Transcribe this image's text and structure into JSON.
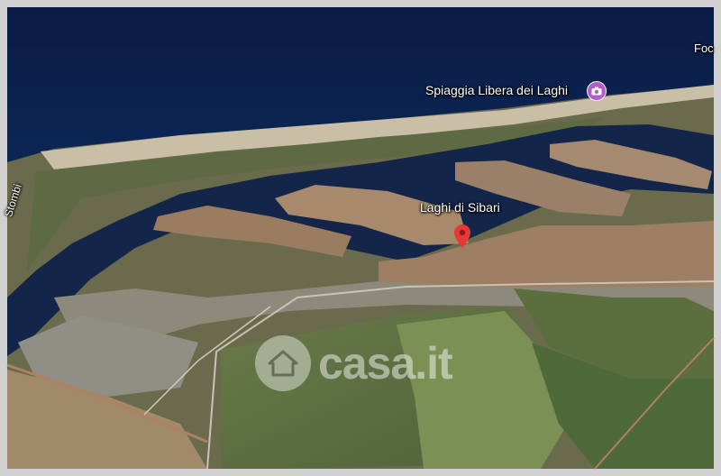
{
  "map": {
    "labels": {
      "beach": "Spiaggia Libera dei Laghi",
      "place": "Laghi di Sibari",
      "river": "Stombi",
      "edge": "Foc"
    },
    "icons": {
      "poi": "camera-icon",
      "marker": "location-pin-icon"
    },
    "colors": {
      "sea": "#0c2453",
      "canal": "#13264a",
      "sand": "#c9bfa6",
      "poi": "#b35ccc",
      "pin": "#e53935"
    }
  },
  "watermark": {
    "text": "casa.it",
    "icon": "house-icon"
  }
}
